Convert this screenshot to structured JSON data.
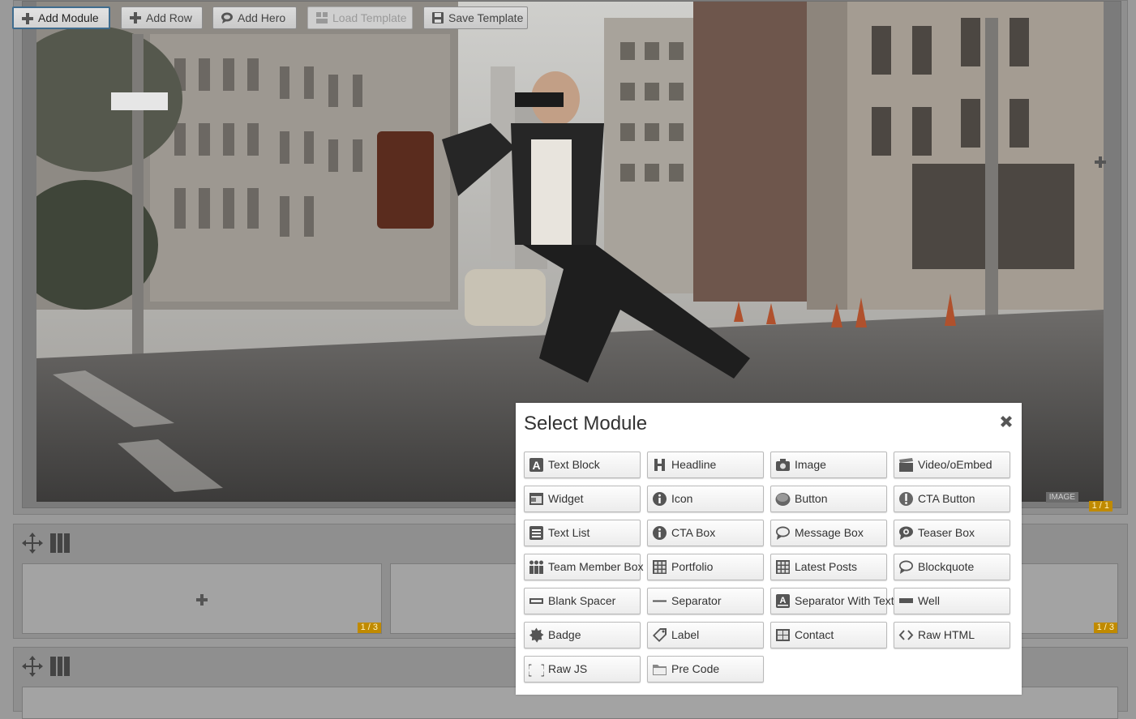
{
  "toolbar": {
    "add_module": "Add Module",
    "add_row": "Add Row",
    "add_hero": "Add Hero",
    "load_template": "Load Template",
    "save_template": "Save Template"
  },
  "hero": {
    "image_tag": "IMAGE",
    "fraction": "1 / 1"
  },
  "rows": [
    {
      "columns": [
        {
          "fraction": "1 / 3"
        },
        {
          "fraction": ""
        },
        {
          "fraction": "1 / 3"
        }
      ]
    },
    {
      "columns": []
    }
  ],
  "modal": {
    "title": "Select Module",
    "modules": [
      {
        "label": "Text Block",
        "icon": "text-block-icon"
      },
      {
        "label": "Headline",
        "icon": "headline-icon"
      },
      {
        "label": "Image",
        "icon": "camera-icon"
      },
      {
        "label": "Video/oEmbed",
        "icon": "clapperboard-icon"
      },
      {
        "label": "Widget",
        "icon": "widget-icon"
      },
      {
        "label": "Icon",
        "icon": "info-icon"
      },
      {
        "label": "Button",
        "icon": "button-icon"
      },
      {
        "label": "CTA Button",
        "icon": "exclamation-icon"
      },
      {
        "label": "Text List",
        "icon": "list-icon"
      },
      {
        "label": "CTA Box",
        "icon": "info-icon"
      },
      {
        "label": "Message Box",
        "icon": "speech-bubble-icon"
      },
      {
        "label": "Teaser Box",
        "icon": "speech-bubble-eye-icon"
      },
      {
        "label": "Team Member Box",
        "icon": "team-icon"
      },
      {
        "label": "Portfolio",
        "icon": "grid-icon"
      },
      {
        "label": "Latest Posts",
        "icon": "grid-icon"
      },
      {
        "label": "Blockquote",
        "icon": "quote-bubble-icon"
      },
      {
        "label": "Blank Spacer",
        "icon": "spacer-icon"
      },
      {
        "label": "Separator",
        "icon": "separator-icon"
      },
      {
        "label": "Separator With Text",
        "icon": "separator-text-icon"
      },
      {
        "label": "Well",
        "icon": "well-icon"
      },
      {
        "label": "Badge",
        "icon": "badge-icon"
      },
      {
        "label": "Label",
        "icon": "tag-icon"
      },
      {
        "label": "Contact",
        "icon": "table-icon"
      },
      {
        "label": "Raw HTML",
        "icon": "code-brackets-icon"
      },
      {
        "label": "Raw JS",
        "icon": "curly-braces-icon"
      },
      {
        "label": "Pre Code",
        "icon": "folder-icon"
      }
    ]
  },
  "colors": {
    "badge": "#c08a00",
    "active_border": "#3f6c8e",
    "overlay_gray": "#8f8f8f"
  }
}
